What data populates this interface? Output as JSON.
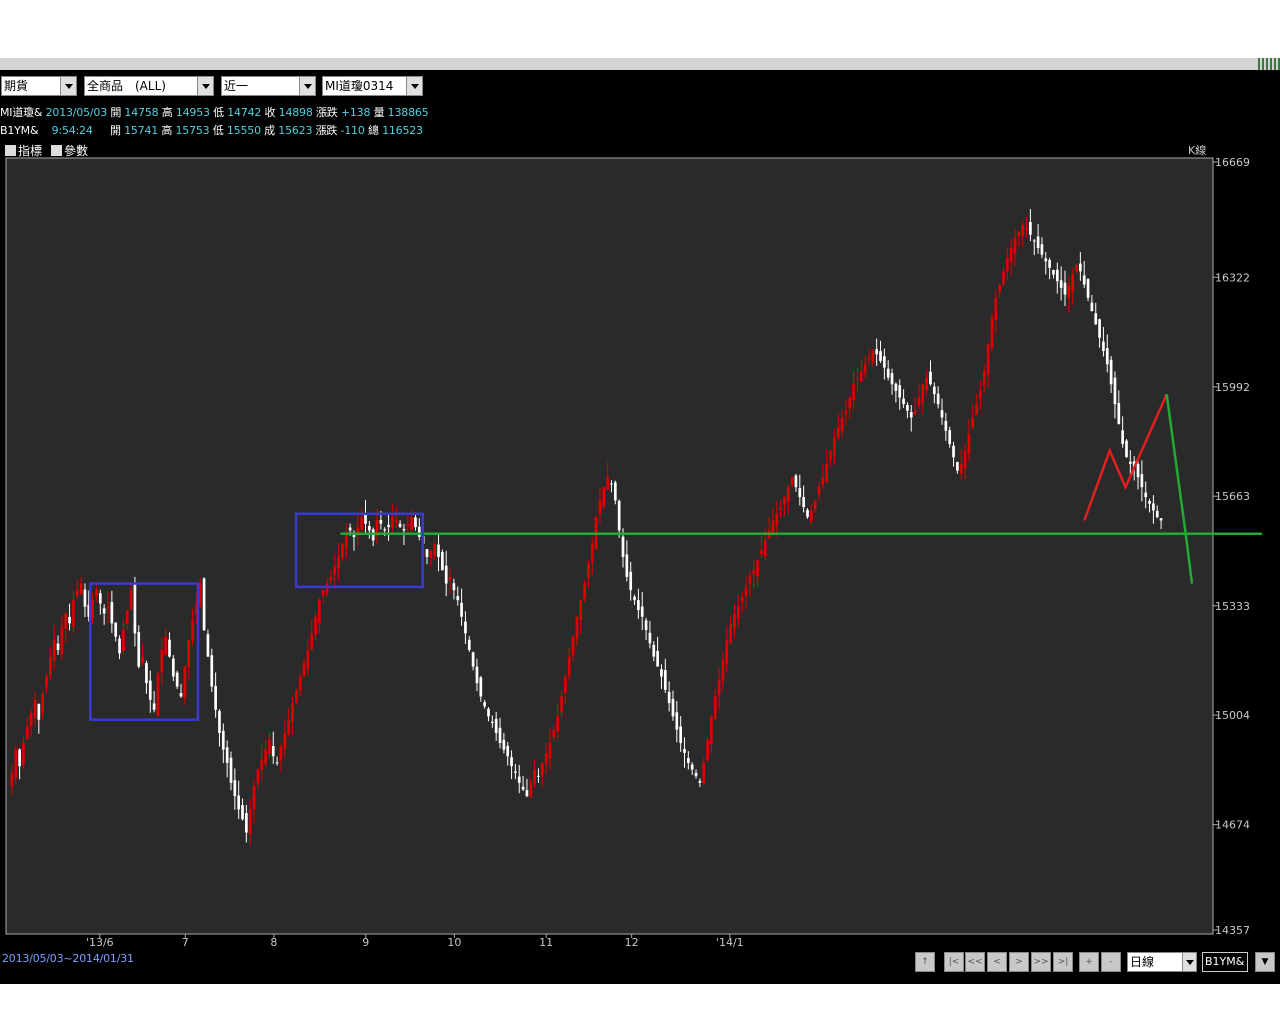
{
  "toolbar": {
    "market": "期貨",
    "product": "全商品　(ALL)",
    "period": "近一",
    "symbol": "MI道瓊0314"
  },
  "quote1": {
    "name": "MI道瓊&",
    "date": "2013/05/03",
    "open_label": "開",
    "open": "14758",
    "high_label": "高",
    "high": "14953",
    "low_label": "低",
    "low": "14742",
    "close_label": "收",
    "close": "14898",
    "change_label": "漲跌",
    "change": "+138",
    "volume_label": "量",
    "volume": "138865"
  },
  "quote2": {
    "name": "B1YM&",
    "time": "9:54:24",
    "open_label": "開",
    "open": "15741",
    "high_label": "高",
    "high": "15753",
    "low_label": "低",
    "low": "15550",
    "last_label": "成",
    "last": "15623",
    "change_label": "漲跌",
    "change": "-110",
    "total_label": "總",
    "total": "116523"
  },
  "panel": {
    "indicator_label": "指標",
    "param_label": "參數",
    "chart_mode": "K線"
  },
  "footer": {
    "date_range": "2013/05/03~2014/01/31",
    "interval": "日線",
    "symbol_box": "B1YM&",
    "nav_buttons": [
      "|<",
      "<<",
      "<",
      ">",
      ">>",
      ">|",
      "+",
      "-"
    ]
  },
  "colors": {
    "up": "#e00000",
    "down": "#ffffff",
    "support_line": "#22aa33",
    "box": "#3a3ad0",
    "projection_red": "#e02020",
    "projection_green": "#22aa33",
    "axis_text": "#c8c8c8"
  },
  "chart_data": {
    "type": "candlestick",
    "x_ticks": [
      "'13/6",
      "7",
      "8",
      "9",
      "10",
      "11",
      "12",
      "'14/1"
    ],
    "y_ticks": [
      16669,
      16322,
      15992,
      15663,
      15333,
      15004,
      14674,
      14357
    ],
    "ylim": [
      14357,
      16669
    ],
    "grid": false,
    "support_level": 15550,
    "boxes": [
      {
        "from_day": 26,
        "to_day": 60,
        "low": 14990,
        "high": 15400
      },
      {
        "from_day": 91,
        "to_day": 131,
        "low": 15390,
        "high": 15610
      }
    ],
    "projection_red": [
      {
        "day": 340,
        "value": 15590
      },
      {
        "day": 348,
        "value": 15800
      },
      {
        "day": 353,
        "value": 15690
      },
      {
        "day": 366,
        "value": 15970
      }
    ],
    "projection_green": [
      {
        "day": 366,
        "value": 15970
      },
      {
        "day": 372,
        "value": 15550
      },
      {
        "day": 374,
        "value": 15400
      }
    ],
    "closes": [
      14830,
      14900,
      14850,
      14920,
      14970,
      15010,
      15050,
      14990,
      15070,
      15120,
      15180,
      15230,
      15200,
      15270,
      15310,
      15280,
      15350,
      15380,
      15400,
      15330,
      15300,
      15350,
      15380,
      15340,
      15310,
      15330,
      15280,
      15240,
      15190,
      15260,
      15320,
      15380,
      15250,
      15150,
      15180,
      15100,
      15050,
      15020,
      15130,
      15200,
      15240,
      15180,
      15120,
      15090,
      15060,
      15150,
      15230,
      15290,
      15340,
      15400,
      15260,
      15180,
      15090,
      15020,
      14950,
      14900,
      14860,
      14800,
      14760,
      14720,
      14690,
      14650,
      14720,
      14790,
      14840,
      14870,
      14900,
      14930,
      14880,
      14860,
      14910,
      14950,
      14990,
      15040,
      15080,
      15120,
      15160,
      15200,
      15250,
      15300,
      15350,
      15380,
      15400,
      15420,
      15450,
      15480,
      15520,
      15550,
      15560,
      15540,
      15570,
      15600,
      15580,
      15560,
      15530,
      15590,
      15580,
      15560,
      15570,
      15600,
      15590,
      15570,
      15560,
      15580,
      15600,
      15570,
      15540,
      15520,
      15480,
      15500,
      15520,
      15480,
      15440,
      15400,
      15420,
      15380,
      15350,
      15300,
      15250,
      15200,
      15150,
      15100,
      15060,
      15030,
      15000,
      14980,
      14950,
      14920,
      14900,
      14880,
      14850,
      14830,
      14800,
      14780,
      14760,
      14800,
      14840,
      14820,
      14860,
      14890,
      14920,
      14960,
      15000,
      15060,
      15120,
      15180,
      15240,
      15300,
      15350,
      15400,
      15460,
      15520,
      15600,
      15650,
      15690,
      15720,
      15700,
      15650,
      15560,
      15480,
      15420,
      15380,
      15350,
      15320,
      15300,
      15260,
      15220,
      15180,
      15150,
      15120,
      15080,
      15040,
      15000,
      14960,
      14920,
      14890,
      14860,
      14840,
      14820,
      14800,
      14860,
      14930,
      15000,
      15060,
      15110,
      15170,
      15230,
      15280,
      15310,
      15330,
      15360,
      15390,
      15420,
      15440,
      15470,
      15500,
      15530,
      15560,
      15590,
      15610,
      15630,
      15660,
      15690,
      15720,
      15690,
      15660,
      15630,
      15600,
      15620,
      15650,
      15690,
      15720,
      15760,
      15800,
      15840,
      15870,
      15900,
      15920,
      15960,
      16000,
      16020,
      16040,
      16060,
      16080,
      16100,
      16090,
      16070,
      16050,
      16020,
      16000,
      15980,
      15960,
      15940,
      15920,
      15900,
      15920,
      15960,
      16000,
      16020,
      16000,
      15970,
      15940,
      15900,
      15860,
      15820,
      15780,
      15740,
      15760,
      15800,
      15850,
      15900,
      15940,
      15980,
      16040,
      16120,
      16200,
      16260,
      16300,
      16340,
      16380,
      16410,
      16440,
      16460,
      16480,
      16470,
      16450,
      16430,
      16410,
      16390,
      16370,
      16350,
      16330,
      16310,
      16290,
      16270,
      16300,
      16330,
      16360,
      16340,
      16300,
      16260,
      16220,
      16180,
      16140,
      16100,
      16060,
      16000,
      15940,
      15880,
      15820,
      15780,
      15760,
      15750,
      15720,
      15690,
      15660,
      15640,
      15620,
      15600,
      15590
    ],
    "total_days": 380
  }
}
